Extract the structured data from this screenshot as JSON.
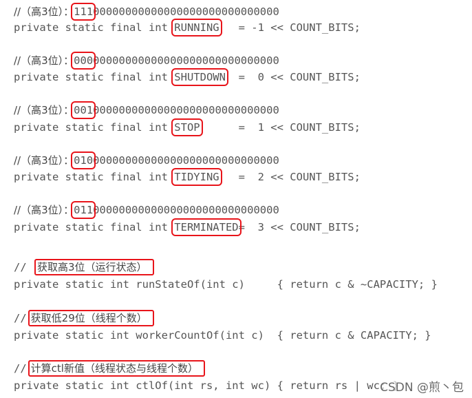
{
  "states": [
    {
      "comment_prefix": "//（高3位）：",
      "bits_high": "111",
      "bits_rest": "00000000000000000000000000000",
      "decl_prefix": "private static final int ",
      "name": "RUNNING",
      "decl_suffix": "   = -1 << COUNT_BITS;"
    },
    {
      "comment_prefix": "//（高3位）：",
      "bits_high": "000",
      "bits_rest": "00000000000000000000000000000",
      "decl_prefix": "private static final int ",
      "name": "SHUTDOWN",
      "decl_suffix": "  =  0 << COUNT_BITS;"
    },
    {
      "comment_prefix": "//（高3位）：",
      "bits_high": "001",
      "bits_rest": "00000000000000000000000000000",
      "decl_prefix": "private static final int ",
      "name": "STOP",
      "decl_suffix": "      =  1 << COUNT_BITS;"
    },
    {
      "comment_prefix": "//（高3位）：",
      "bits_high": "010",
      "bits_rest": "00000000000000000000000000000",
      "decl_prefix": "private static final int ",
      "name": "TIDYING",
      "decl_suffix": "   =  2 << COUNT_BITS;"
    },
    {
      "comment_prefix": "//（高3位）：",
      "bits_high": "011",
      "bits_rest": "00000000000000000000000000000",
      "decl_prefix": "private static final int ",
      "name": "TERMINATED",
      "decl_suffix": "=  3 << COUNT_BITS;"
    }
  ],
  "methods": [
    {
      "comment_prefix": "// ",
      "comment": "获取高3位（运行状态）",
      "code": "private static int runStateOf(int c)     { return c & ~CAPACITY; }"
    },
    {
      "comment_prefix": "//",
      "comment": "获取低29位（线程个数）",
      "code": "private static int workerCountOf(int c)  { return c & CAPACITY; }"
    },
    {
      "comment_prefix": "//",
      "comment": "计算ctl新值（线程状态与线程个数）",
      "code": "private static int ctlOf(int rs, int wc) { return rs | wc; }"
    }
  ],
  "watermark": "CSDN @煎丶包",
  "highlight_color": "#e8141a"
}
